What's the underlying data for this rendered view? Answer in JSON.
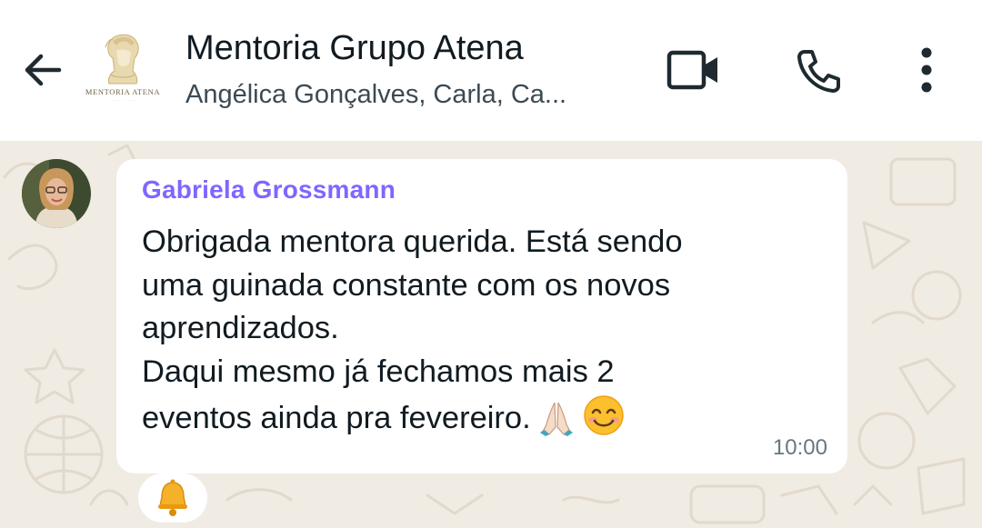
{
  "header": {
    "title": "Mentoria Grupo Atena",
    "subtitle": "Angélica Gonçalves, Carla, Ca...",
    "logo_caption": "MENTORIA ATENA",
    "back_icon": "arrow-back-icon",
    "video_icon": "video-call-icon",
    "call_icon": "phone-icon",
    "menu_icon": "more-vertical-icon"
  },
  "message": {
    "sender": "Gabriela Grossmann",
    "lines": [
      "Obrigada mentora querida. Está sendo",
      "uma guinada constante com os novos",
      "aprendizados.",
      "Daqui mesmo já fechamos mais 2",
      "eventos ainda pra fevereiro."
    ],
    "emojis": [
      "🙏",
      "☺️"
    ],
    "time": "10:00",
    "reaction": "🔔"
  },
  "colors": {
    "header_bg": "#ffffff",
    "chat_bg": "#f0ebe3",
    "bubble_bg": "#ffffff",
    "sender_name": "#7f66ff",
    "text": "#111b21",
    "timestamp": "#667781"
  }
}
